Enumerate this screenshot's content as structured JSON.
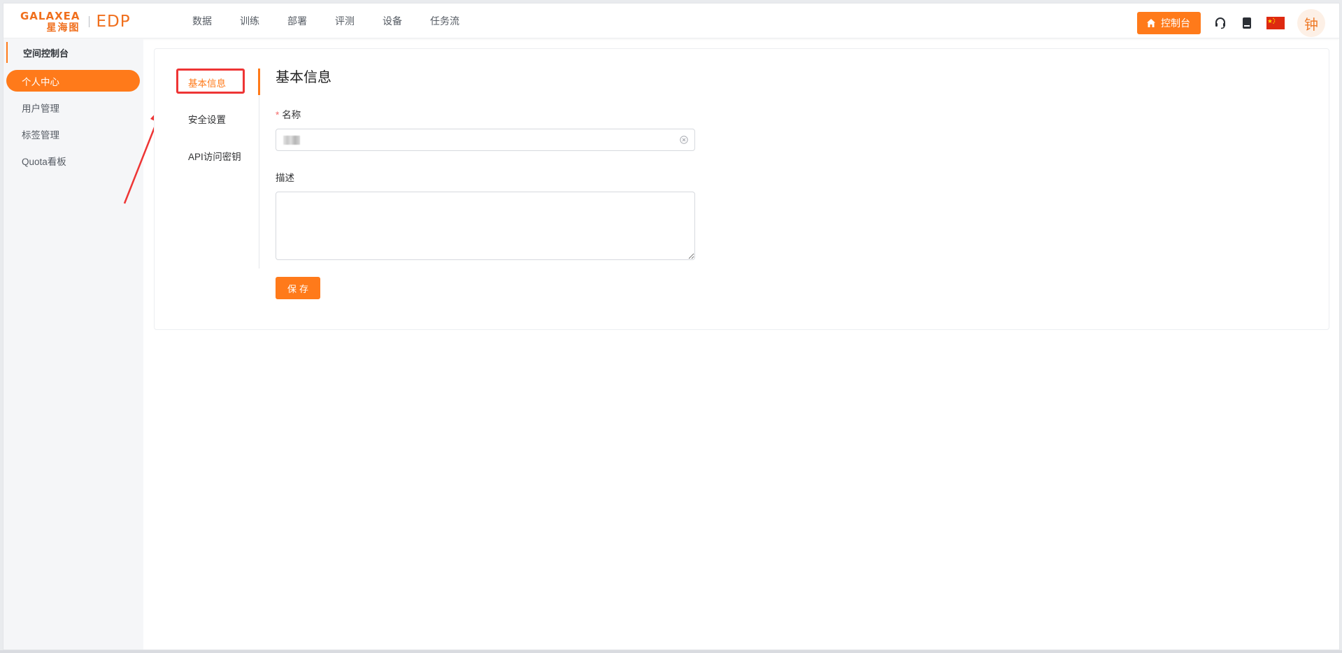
{
  "header": {
    "logo_word": "GALAXEA",
    "logo_cn": "星海图",
    "logo_product": "EDP",
    "nav": [
      "数据",
      "训练",
      "部署",
      "评测",
      "设备",
      "任务流"
    ],
    "console_button": "控制台",
    "avatar_text": "钟",
    "icons": [
      "home-icon",
      "headset-icon",
      "book-icon",
      "china-flag-icon"
    ]
  },
  "sidebar": {
    "title": "空间控制台",
    "items": [
      {
        "label": "个人中心",
        "active": true
      },
      {
        "label": "用户管理",
        "active": false
      },
      {
        "label": "标签管理",
        "active": false
      },
      {
        "label": "Quota看板",
        "active": false
      }
    ]
  },
  "tabs": [
    {
      "label": "基本信息",
      "active": true
    },
    {
      "label": "安全设置",
      "active": false
    },
    {
      "label": "API访问密钥",
      "active": false
    }
  ],
  "form": {
    "title": "基本信息",
    "name_label": "名称",
    "name_value": "",
    "desc_label": "描述",
    "desc_value": "",
    "save_label": "保存"
  },
  "colors": {
    "accent": "#ff7a1a",
    "annotation_red": "#ee3535"
  }
}
